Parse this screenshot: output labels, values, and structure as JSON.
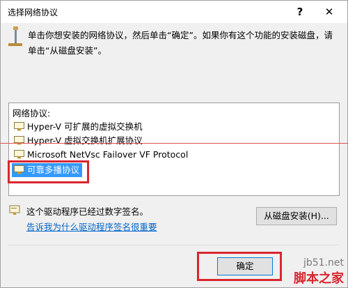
{
  "window": {
    "title": "选择网络协议",
    "help_label": "?",
    "close_label": "✕"
  },
  "instruction": "单击你想安装的网络协议，然后单击“确定”。如果你有这个功能的安装磁盘，请单击“从磁盘安装”。",
  "list": {
    "caption": "网络协议:",
    "items": [
      {
        "label": "Hyper-V 可扩展的虚拟交换机",
        "selected": false
      },
      {
        "label": "Hyper-V 虚拟交换机扩展协议",
        "selected": false
      },
      {
        "label": "Microsoft NetVsc Failover VF Protocol",
        "selected": false
      },
      {
        "label": "可靠多播协议",
        "selected": true
      }
    ]
  },
  "signature": {
    "text": "这个驱动程序已经过数字签名。",
    "link": "告诉我为什么驱动程序签名很重要"
  },
  "buttons": {
    "have_disk": "从磁盘安装(H)...",
    "ok": "确定"
  },
  "watermark": {
    "url": "jb51.net",
    "name": "脚本之家"
  },
  "colors": {
    "selection": "#3399ff",
    "annotation_red": "#d9262f",
    "link": "#0066cc"
  }
}
